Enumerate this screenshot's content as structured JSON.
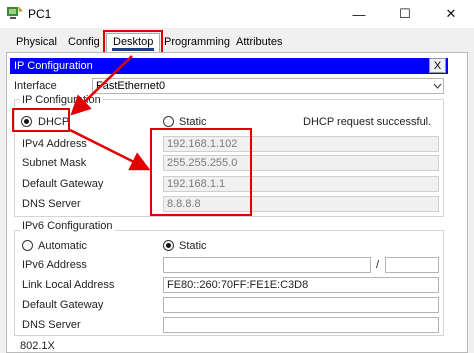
{
  "window": {
    "title": "PC1",
    "minimize": "—",
    "maximize": "☐",
    "close": "✕"
  },
  "tabs": [
    "Physical",
    "Config",
    "Desktop",
    "Programming",
    "Attributes"
  ],
  "ip_config": {
    "header": "IP Configuration",
    "close": "X",
    "interface_label": "Interface",
    "interface_value": "FastEthernet0",
    "ipv4": {
      "group_label": "IP Configuration",
      "dhcp_label": "DHCP",
      "static_label": "Static",
      "status": "DHCP request successful.",
      "address_label": "IPv4 Address",
      "address_value": "192.168.1.102",
      "mask_label": "Subnet Mask",
      "mask_value": "255.255.255.0",
      "gateway_label": "Default Gateway",
      "gateway_value": "192.168.1.1",
      "dns_label": "DNS Server",
      "dns_value": "8.8.8.8"
    },
    "ipv6": {
      "group_label": "IPv6 Configuration",
      "automatic_label": "Automatic",
      "static_label": "Static",
      "address_label": "IPv6 Address",
      "address_value": "",
      "separator": "/",
      "prefix_value": "",
      "link_local_label": "Link Local Address",
      "link_local_value": "FE80::260:70FF:FE1E:C3D8",
      "gateway_label": "Default Gateway",
      "gateway_value": "",
      "dns_label": "DNS Server",
      "dns_value": ""
    },
    "dot1x_label": "802.1X"
  },
  "colors": {
    "accent": "#0000ff",
    "highlight": "#e00000",
    "selected_tab_underline": "#1e3a8a"
  }
}
